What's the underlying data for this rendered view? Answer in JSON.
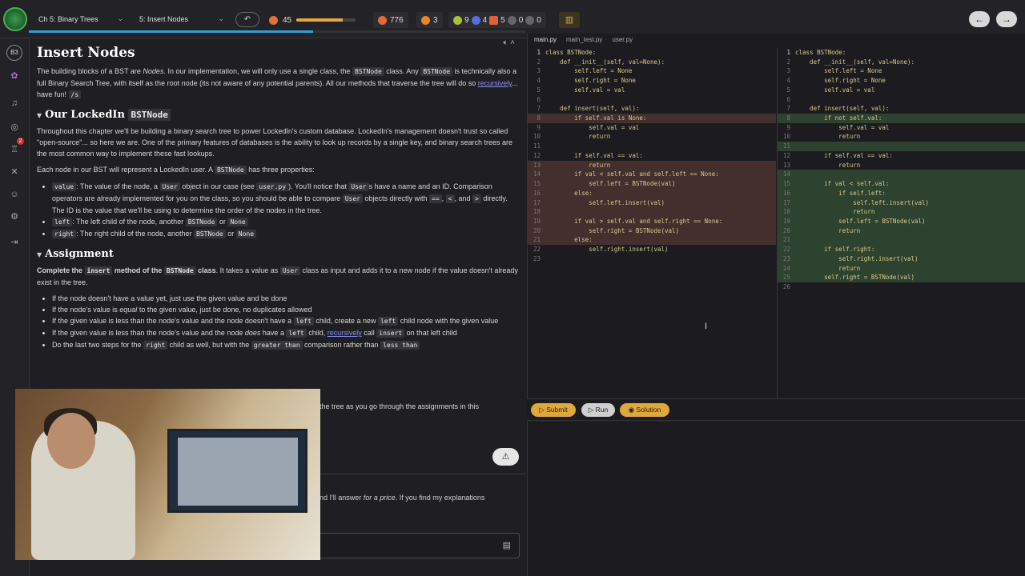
{
  "topbar": {
    "chapter_select": "Ch 5: Binary Trees",
    "lesson_select": "5: Insert Nodes",
    "undo_icon": "↶",
    "xp_level": "45",
    "xp_progress": 0.78,
    "gems": "776",
    "streak": "3",
    "potions": "9",
    "shields": "4",
    "chests": "5",
    "empty_a": "0",
    "empty_b": "0",
    "back_icon": "←",
    "forward_icon": "→"
  },
  "sidebar": {
    "avatar_initials": "B3",
    "notification_count": "2",
    "icons": [
      "avatar-icon",
      "purple-icon",
      "bell-icon",
      "gear-icon",
      "trophy-icon",
      "tools-icon",
      "community-icon",
      "settings-icon",
      "logout-icon"
    ]
  },
  "lesson": {
    "title": "Insert Nodes",
    "intro_1": "The building blocks of a BST are ",
    "intro_nodes": "Nodes",
    "intro_2": ". In our implementation, we will only use a single class, the ",
    "intro_code1": "BSTNode",
    "intro_3": " class. Any ",
    "intro_code2": "BSTNode",
    "intro_4": " is technically also a full Binary Search Tree, with itself as the root node (its not aware of any potential parents). All our methods that traverse the tree will do so ",
    "intro_link": "recursively",
    "intro_5": "... have fun! ",
    "intro_code3": "/s",
    "section1_title_text": "Our LockedIn ",
    "section1_title_code": "BSTNode",
    "s1_p1": "Throughout this chapter we'll be building a binary search tree to power LockedIn's custom database. LockedIn's management doesn't trust so called \"open-source\"... so here we are. One of the primary features of databases is the ability to look up records by a single key, and binary search trees are the most common way to implement these fast lookups.",
    "s1_p2a": "Each node in our BST will represent a LockedIn user. A ",
    "s1_p2_code": "BSTNode",
    "s1_p2b": " has three properties:",
    "prop_value_code": "value",
    "prop_value_a": ": The value of the node, a ",
    "prop_value_code2": "User",
    "prop_value_b": " object in our case (see ",
    "prop_value_code3": "user.py",
    "prop_value_c": "). You'll notice that ",
    "prop_value_code4": "User",
    "prop_value_d": "s have a name and an ID. Comparison operators are already implemented for you on the class, so you should be able to compare ",
    "prop_value_code5": "User",
    "prop_value_e": " objects directly with ",
    "prop_value_code6": "==",
    "prop_value_f": ", ",
    "prop_value_code7": "<",
    "prop_value_g": ", and ",
    "prop_value_code8": ">",
    "prop_value_h": " directly. The ID is the value that we'll be using to determine the order of the nodes in the tree.",
    "prop_left_code": "left",
    "prop_left_a": ": The left child of the node, another ",
    "prop_left_code2": "BSTNode",
    "prop_left_b": " or ",
    "prop_left_code3": "None",
    "prop_right_code": "right",
    "prop_right_a": ": The right child of the node, another ",
    "prop_right_code2": "BSTNode",
    "prop_right_b": " or ",
    "prop_right_code3": "None",
    "section2_title": "Assignment",
    "a_bold1": "Complete the ",
    "a_code1": "insert",
    "a_bold2": " method of the ",
    "a_code2": "BSTNode",
    "a_bold3": " class",
    "a_rest1": ". It takes a value as ",
    "a_code3": "User",
    "a_rest2": " class as input and adds it to a new node if the value doesn't already exist in the tree.",
    "b1": "If the node doesn't have a value yet, just use the given value and be done",
    "b2a": "If the node's value is ",
    "b2_em": "equal",
    "b2b": " to the given value, just be done, no duplicates allowed",
    "b3a": "If the given value is less than the node's value and the node doesn't have a ",
    "b3_code": "left",
    "b3b": " child, create a new ",
    "b3_code2": "left",
    "b3c": " child node with the given value",
    "b4a": "If the given value is less than the node's value and the node ",
    "b4_em": "does",
    "b4b": " have a ",
    "b4_code": "left",
    "b4c": " child, ",
    "b4_link": "recursively",
    "b4d": " call ",
    "b4_code2": "insert",
    "b4e": " on that left child",
    "b5a": "Do the last two steps for the ",
    "b5_code": "right",
    "b5b": " child as well, but with the ",
    "b5_code2": "greater than",
    "b5c": " comparison rather than ",
    "b5_code3": "less than",
    "tail_text": "the tree as you go through the assignments in this",
    "chat_text_a": "nd I'll answer ",
    "chat_text_em": "for a price",
    "chat_text_b": ". If you find my explanations"
  },
  "editor": {
    "tabs": [
      "main.py",
      "main_test.py",
      "user.py"
    ],
    "left_lines": [
      "class BSTNode:",
      "    def __init__(self, val=None):",
      "        self.left = None",
      "        self.right = None",
      "        self.val = val",
      "",
      "    def insert(self, val):",
      "        if self.val is None:",
      "            self.val = val",
      "            return",
      "",
      "        if self.val == val:",
      "            return",
      "        if val < self.val and self.left == None:",
      "            self.left = BSTNode(val)",
      "        else:",
      "            self.left.insert(val)",
      "",
      "        if val > self.val and self.right == None:",
      "            self.right = BSTNode(val)",
      "        else:",
      "            self.right.insert(val)",
      ""
    ],
    "right_lines": [
      "class BSTNode:",
      "    def __init__(self, val=None):",
      "        self.left = None",
      "        self.right = None",
      "        self.val = val",
      "",
      "    def insert(self, val):",
      "        if not self.val:",
      "            self.val = val",
      "            return",
      "",
      "        if self.val == val:",
      "            return",
      "",
      "        if val < self.val:",
      "            if self.left:",
      "                self.left.insert(val)",
      "                return",
      "            self.left = BSTNode(val)",
      "            return",
      "",
      "        if self.right:",
      "            self.right.insert(val)",
      "            return",
      "        self.right = BSTNode(val)",
      ""
    ]
  },
  "actions": {
    "submit": "Submit",
    "run": "Run",
    "solution": "Solution"
  }
}
